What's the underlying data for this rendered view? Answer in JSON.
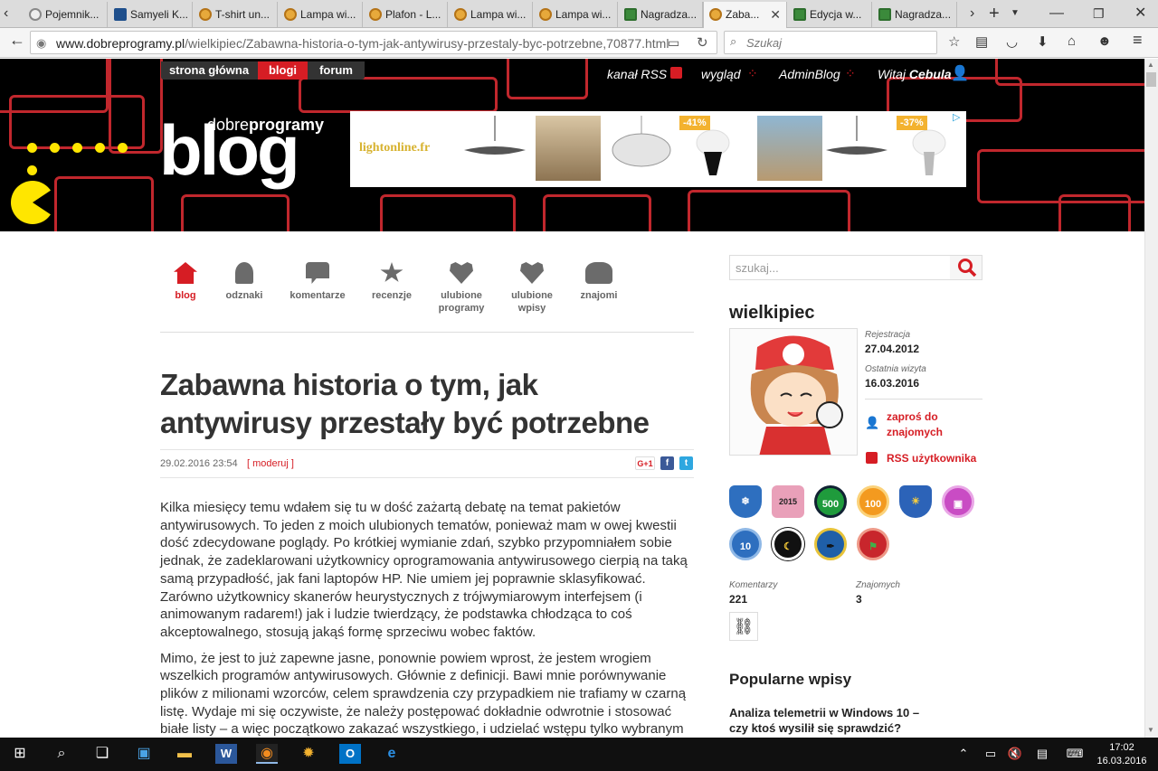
{
  "browser": {
    "tabs": [
      {
        "title": "Pojemnik..."
      },
      {
        "title": "Samyeli K..."
      },
      {
        "title": "T-shirt un..."
      },
      {
        "title": "Lampa wi..."
      },
      {
        "title": "Plafon - L..."
      },
      {
        "title": "Lampa wi..."
      },
      {
        "title": "Lampa wi..."
      },
      {
        "title": "Nagradza..."
      },
      {
        "title": "Zaba..."
      },
      {
        "title": "Edycja w..."
      },
      {
        "title": "Nagradza..."
      }
    ],
    "url_domain": "www.dobreprogramy.pl",
    "url_path": "/wielkipiec/Zabawna-historia-o-tym-jak-antywirusy-przestaly-byc-potrzebne,70877.html",
    "search_placeholder": "Szukaj"
  },
  "header": {
    "nav": [
      "strona główna",
      "blogi",
      "forum"
    ],
    "rss_label": "kanał RSS",
    "appearance_label": "wygląd",
    "adminblog_label": "AdminBlog",
    "greeting": "Witaj",
    "greeting_user": "Cebula",
    "logo_small_pre": "dobre",
    "logo_small_bold": "programy",
    "logo_big": "blog",
    "ad": {
      "brand": "lightonline.fr",
      "discount_1": "-41%",
      "discount_2": "-37%"
    }
  },
  "blog_nav": [
    {
      "label": "blog"
    },
    {
      "label": "odznaki"
    },
    {
      "label": "komentarze"
    },
    {
      "label": "recenzje"
    },
    {
      "label": "ulubione programy"
    },
    {
      "label": "ulubione wpisy"
    },
    {
      "label": "znajomi"
    }
  ],
  "post": {
    "title": "Zabawna historia o tym, jak antywirusy przestały być potrzebne",
    "date": "29.02.2016 23:54",
    "moderate": "[ moderuj ]",
    "paragraphs": [
      "Kilka miesięcy temu wdałem się tu w dość zażartą debatę na temat pakietów antywirusowych. To jeden z moich ulubionych tematów, ponieważ mam w owej kwestii dość zdecydowane poglądy. Po krótkiej wymianie zdań, szybko przypomniałem sobie jednak, że zadeklarowani użytkownicy oprogramowania antywirusowego cierpią na taką samą przypadłość, jak fani laptopów HP. Nie umiem jej poprawnie sklasyfikować. Zarówno użytkownicy skanerów heurystycznych z trójwymiarowym interfejsem (i animowanym radarem!) jak i ludzie twierdzący, że podstawka chłodząca to coś akceptowalnego, stosują jakąś formę sprzeciwu wobec faktów.",
      "Mimo, że jest to już zapewne jasne, ponownie powiem wprost, że jestem wrogiem wszelkich programów antywirusowych. Głównie z definicji. Bawi mnie porównywanie plików z milionami wzorców, celem sprawdzenia czy przypadkiem nie trafiamy w czarną listę. Wydaje mi się oczywiste, że należy postępować dokładnie odwrotnie i stosować białe listy – a więc początkowo zakazać wszystkiego, i udzielać wstępu tylko wybranym elementom. W"
    ]
  },
  "sidebar": {
    "search_placeholder": "szukaj...",
    "user": "wielkipiec",
    "registration_label": "Rejestracja",
    "registration_date": "27.04.2012",
    "last_visit_label": "Ostatnia wizyta",
    "last_visit_date": "16.03.2016",
    "invite_label": "zaproś do znajomych",
    "rss_user_label": "RSS użytkownika",
    "badges": [
      {
        "text": "",
        "color": "#2e6fbf"
      },
      {
        "text": "2015",
        "color": "#e9a0b9"
      },
      {
        "text": "500",
        "color": "#1f9b3c"
      },
      {
        "text": "100",
        "color": "#f39a1f"
      },
      {
        "text": "",
        "color": "#2c63b8"
      },
      {
        "text": "",
        "color": "#c94cc4"
      },
      {
        "text": "10",
        "color": "#2e6fbf"
      },
      {
        "text": "",
        "color": "#111111"
      },
      {
        "text": "",
        "color": "#1f5fa8"
      },
      {
        "text": "",
        "color": "#c8262c"
      }
    ],
    "comments_label": "Komentarzy",
    "comments_count": "221",
    "friends_label": "Znajomych",
    "friends_count": "3",
    "popular_title": "Popularne wpisy",
    "popular_first": "Analiza telemetrii w Windows 10 – czy ktoś wysilił się sprawdzić?"
  },
  "taskbar": {
    "time": "17:02",
    "date": "16.03.2016"
  },
  "colors": {
    "accent": "#d61d24",
    "pacman": "#ffe600"
  }
}
